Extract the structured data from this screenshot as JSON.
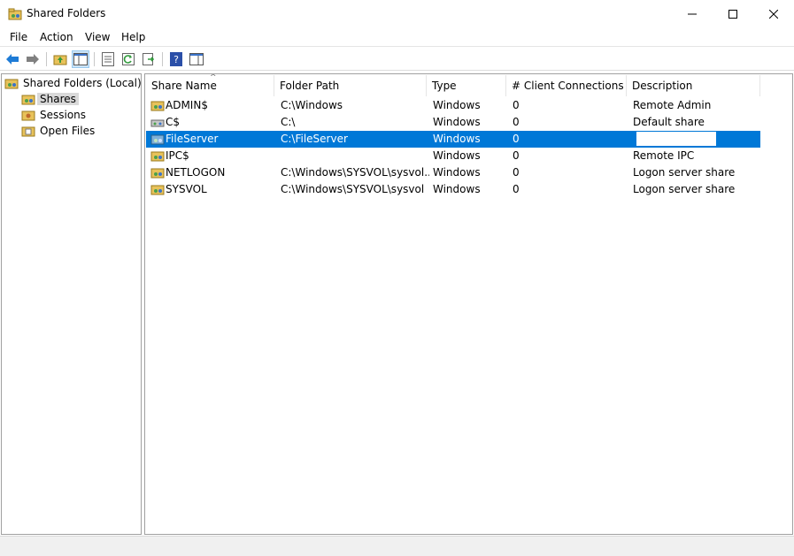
{
  "window": {
    "title": "Shared Folders",
    "icon": "shared-folder-icon"
  },
  "menu": {
    "items": [
      "File",
      "Action",
      "View",
      "Help"
    ]
  },
  "toolbar": {
    "buttons": [
      "back-icon",
      "forward-icon",
      "up-folder-icon",
      "show-hide-tree-icon",
      "properties-icon",
      "refresh-icon",
      "export-list-icon",
      "help-icon",
      "show-hide-action-pane-icon"
    ]
  },
  "tree": {
    "root": "Shared Folders (Local)",
    "children": [
      "Shares",
      "Sessions",
      "Open Files"
    ],
    "selected": "Shares"
  },
  "list": {
    "columns": [
      "Share Name",
      "Folder Path",
      "Type",
      "# Client Connections",
      "Description"
    ],
    "rows": [
      {
        "name": "ADMIN$",
        "path": "C:\\Windows",
        "type": "Windows",
        "connections": "0",
        "description": "Remote Admin"
      },
      {
        "name": "C$",
        "path": "C:\\",
        "type": "Windows",
        "connections": "0",
        "description": "Default share"
      },
      {
        "name": "FileServer",
        "path": "C:\\FileServer",
        "type": "Windows",
        "connections": "0",
        "description": ""
      },
      {
        "name": "IPC$",
        "path": "",
        "type": "Windows",
        "connections": "0",
        "description": "Remote IPC"
      },
      {
        "name": "NETLOGON",
        "path": "C:\\Windows\\SYSVOL\\sysvol...",
        "type": "Windows",
        "connections": "0",
        "description": "Logon server share"
      },
      {
        "name": "SYSVOL",
        "path": "C:\\Windows\\SYSVOL\\sysvol",
        "type": "Windows",
        "connections": "0",
        "description": "Logon server share"
      }
    ],
    "selected_row": "FileServer"
  },
  "colors": {
    "selection": "#0078d7",
    "tree_selection": "#d9d9d9",
    "accent_arrow": "#1e7bd6"
  }
}
